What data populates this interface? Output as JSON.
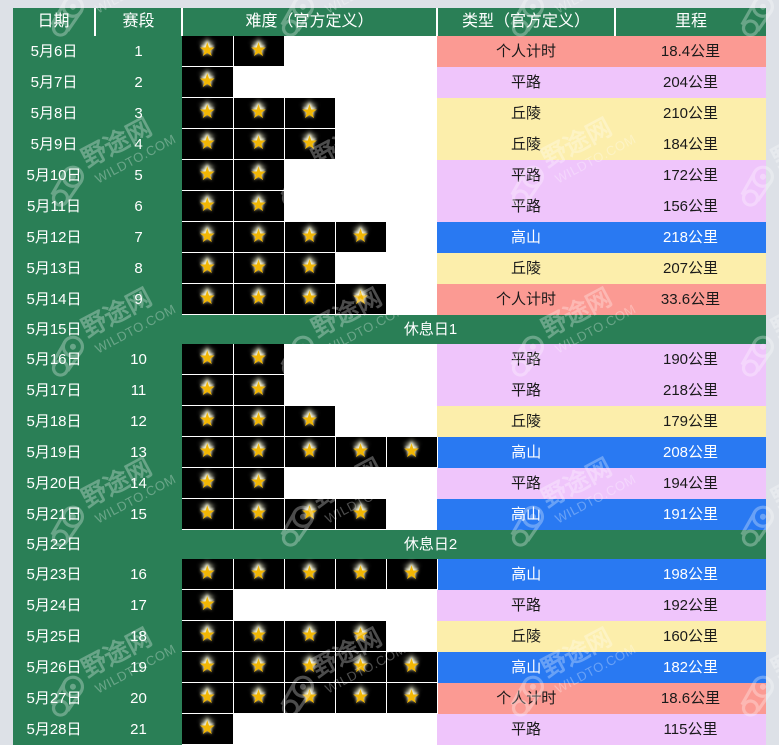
{
  "table": {
    "headers": {
      "date": "日期",
      "stage": "赛段",
      "difficulty": "难度（官方定义）",
      "type": "类型（官方定义）",
      "distance": "里程"
    },
    "star_columns": 5,
    "star_glyph": "★",
    "category_colors": {
      "个人计时": "#fb9a93",
      "平路": "#efc5fb",
      "丘陵": "#fceeab",
      "高山": "#2979f2"
    },
    "header_color": "#2a7f56",
    "rows": [
      {
        "kind": "stage",
        "date": "5月6日",
        "stage": "1",
        "stars": 2,
        "type": "个人计时",
        "cat": "itt",
        "distance": "18.4公里"
      },
      {
        "kind": "stage",
        "date": "5月7日",
        "stage": "2",
        "stars": 1,
        "type": "平路",
        "cat": "flat",
        "distance": "204公里"
      },
      {
        "kind": "stage",
        "date": "5月8日",
        "stage": "3",
        "stars": 3,
        "type": "丘陵",
        "cat": "hill",
        "distance": "210公里"
      },
      {
        "kind": "stage",
        "date": "5月9日",
        "stage": "4",
        "stars": 3,
        "type": "丘陵",
        "cat": "hill",
        "distance": "184公里"
      },
      {
        "kind": "stage",
        "date": "5月10日",
        "stage": "5",
        "stars": 2,
        "type": "平路",
        "cat": "flat",
        "distance": "172公里"
      },
      {
        "kind": "stage",
        "date": "5月11日",
        "stage": "6",
        "stars": 2,
        "type": "平路",
        "cat": "flat",
        "distance": "156公里"
      },
      {
        "kind": "stage",
        "date": "5月12日",
        "stage": "7",
        "stars": 4,
        "type": "高山",
        "cat": "mtn",
        "distance": "218公里"
      },
      {
        "kind": "stage",
        "date": "5月13日",
        "stage": "8",
        "stars": 3,
        "type": "丘陵",
        "cat": "hill",
        "distance": "207公里"
      },
      {
        "kind": "stage",
        "date": "5月14日",
        "stage": "9",
        "stars": 4,
        "type": "个人计时",
        "cat": "itt",
        "distance": "33.6公里"
      },
      {
        "kind": "rest",
        "date": "5月15日",
        "label": "休息日1"
      },
      {
        "kind": "stage",
        "date": "5月16日",
        "stage": "10",
        "stars": 2,
        "type": "平路",
        "cat": "flat",
        "distance": "190公里"
      },
      {
        "kind": "stage",
        "date": "5月17日",
        "stage": "11",
        "stars": 2,
        "type": "平路",
        "cat": "flat",
        "distance": "218公里"
      },
      {
        "kind": "stage",
        "date": "5月18日",
        "stage": "12",
        "stars": 3,
        "type": "丘陵",
        "cat": "hill",
        "distance": "179公里"
      },
      {
        "kind": "stage",
        "date": "5月19日",
        "stage": "13",
        "stars": 5,
        "type": "高山",
        "cat": "mtn",
        "distance": "208公里"
      },
      {
        "kind": "stage",
        "date": "5月20日",
        "stage": "14",
        "stars": 2,
        "type": "平路",
        "cat": "flat",
        "distance": "194公里"
      },
      {
        "kind": "stage",
        "date": "5月21日",
        "stage": "15",
        "stars": 4,
        "type": "高山",
        "cat": "mtn",
        "distance": "191公里"
      },
      {
        "kind": "rest",
        "date": "5月22日",
        "label": "休息日2"
      },
      {
        "kind": "stage",
        "date": "5月23日",
        "stage": "16",
        "stars": 5,
        "type": "高山",
        "cat": "mtn",
        "distance": "198公里"
      },
      {
        "kind": "stage",
        "date": "5月24日",
        "stage": "17",
        "stars": 1,
        "type": "平路",
        "cat": "flat",
        "distance": "192公里"
      },
      {
        "kind": "stage",
        "date": "5月25日",
        "stage": "18",
        "stars": 4,
        "type": "丘陵",
        "cat": "hill",
        "distance": "160公里"
      },
      {
        "kind": "stage",
        "date": "5月26日",
        "stage": "19",
        "stars": 5,
        "type": "高山",
        "cat": "mtn",
        "distance": "182公里"
      },
      {
        "kind": "stage",
        "date": "5月27日",
        "stage": "20",
        "stars": 5,
        "type": "个人计时",
        "cat": "itt",
        "distance": "18.6公里"
      },
      {
        "kind": "stage",
        "date": "5月28日",
        "stage": "21",
        "stars": 1,
        "type": "平路",
        "cat": "flat",
        "distance": "115公里"
      }
    ]
  },
  "watermark": {
    "text_cn": "野途网",
    "text_en": "WILDTO.COM",
    "icon": "bike-chain-link-icon"
  }
}
